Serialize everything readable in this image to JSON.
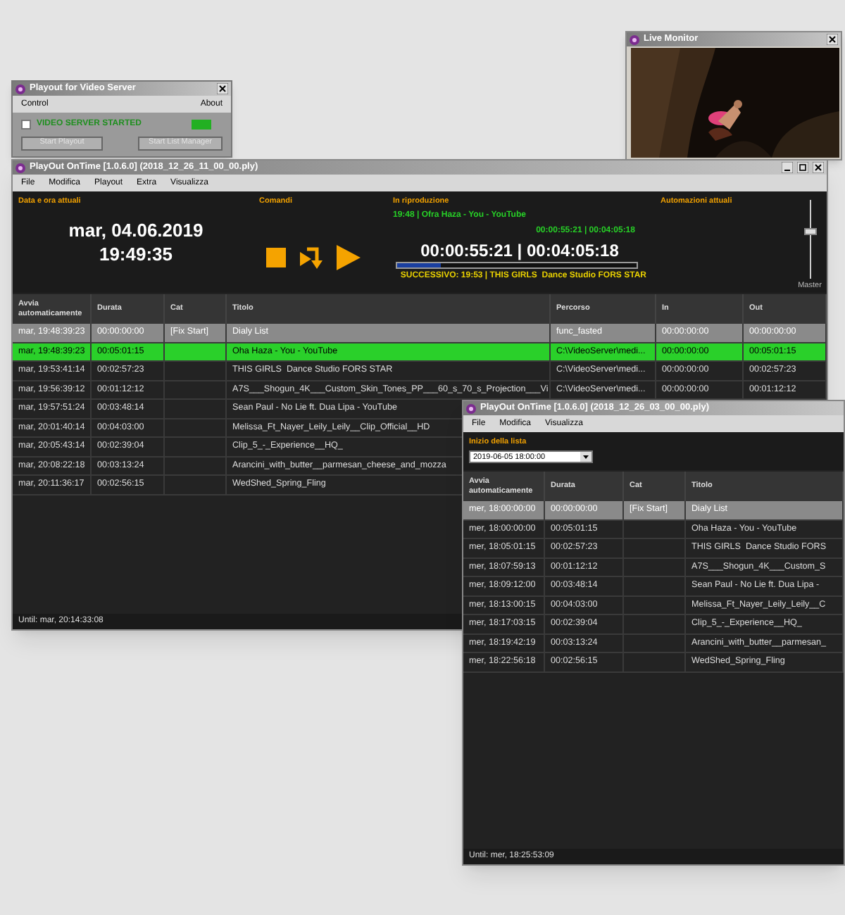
{
  "server_window": {
    "title": "Playout for Video Server",
    "menu": [
      "Control",
      "About"
    ],
    "checkbox": {
      "label": "VIDEO SERVER STARTED",
      "checked": false
    },
    "indicator": {
      "on": true
    },
    "buttons": [
      {
        "label": "Start Playout",
        "disabled": true
      },
      {
        "label": "Start List Manager",
        "disabled": true
      }
    ]
  },
  "monitor_window": {
    "title": "Live Monitor"
  },
  "main_window": {
    "title": "PlayOut OnTime [1.0.6.0] (2018_12_26_11_00_00.ply)",
    "menu": [
      "File",
      "Modifica",
      "Playout",
      "Extra",
      "Visualizza"
    ],
    "panel": {
      "date_label": "Data e ora attuali",
      "date": "mar, 04.06.2019",
      "time": "19:49:35",
      "commands_label": "Comandi",
      "now_playing_label": "In riproduzione",
      "now_playing": "19:48 | Ofra Haza - You - YouTube",
      "elapsed_small": "00:00:55:21 | 00:04:05:18",
      "elapsed": "00:00:55:21 | 00:04:05:18",
      "progress": {
        "level": 0.18
      },
      "next": "SUCCESSIVO: 19:53 | THIS GIRLS  Dance Studio FORS STAR",
      "automations_label": "Automazioni attuali",
      "master": {
        "label": "Master",
        "level": 0.6
      }
    },
    "columns": [
      "Avvia automaticamente",
      "Durata",
      "Cat",
      "Titolo",
      "Percorso",
      "In",
      "Out"
    ],
    "rows": [
      {
        "cells": [
          "mar, 19:48:39:23",
          "00:00:00:00",
          "[Fix Start]",
          "Dialy List",
          "func_fasted",
          "00:00:00:00",
          "00:00:00:00"
        ],
        "selected": true,
        "playing": false
      },
      {
        "cells": [
          "mar, 19:48:39:23",
          "00:05:01:15",
          "",
          "Oha Haza - You - YouTube",
          "C:\\VideoServer\\medi...",
          "00:00:00:00",
          "00:05:01:15"
        ],
        "selected": false,
        "playing": true
      },
      {
        "cells": [
          "mar, 19:53:41:14",
          "00:02:57:23",
          "",
          "THIS GIRLS  Dance Studio FORS STAR",
          "C:\\VideoServer\\medi...",
          "00:00:00:00",
          "00:02:57:23"
        ],
        "selected": false,
        "playing": false
      },
      {
        "cells": [
          "mar, 19:56:39:12",
          "00:01:12:12",
          "",
          "A7S___Shogun_4K___Custom_Skin_Tones_PP___60_s_70_s_Projection___Vi",
          "C:\\VideoServer\\medi...",
          "00:00:00:00",
          "00:01:12:12"
        ],
        "selected": false,
        "playing": false
      },
      {
        "cells": [
          "mar, 19:57:51:24",
          "00:03:48:14",
          "",
          "Sean Paul - No Lie ft. Dua Lipa - YouTube"
        ],
        "selected": false,
        "playing": false
      },
      {
        "cells": [
          "mar, 20:01:40:14",
          "00:04:03:00",
          "",
          "Melissa_Ft_Nayer_Leily_Leily__Clip_Official__HD"
        ],
        "selected": false,
        "playing": false
      },
      {
        "cells": [
          "mar, 20:05:43:14",
          "00:02:39:04",
          "",
          "Clip_5_-_Experience__HQ_"
        ],
        "selected": false,
        "playing": false
      },
      {
        "cells": [
          "mar, 20:08:22:18",
          "00:03:13:24",
          "",
          "Arancini_with_butter__parmesan_cheese_and_mozza"
        ],
        "selected": false,
        "playing": false
      },
      {
        "cells": [
          "mar, 20:11:36:17",
          "00:02:56:15",
          "",
          "WedShed_Spring_Fling"
        ],
        "selected": false,
        "playing": false
      }
    ],
    "status": "Until: mar, 20:14:33:08"
  },
  "list_window": {
    "title": "PlayOut OnTime [1.0.6.0] (2018_12_26_03_00_00.ply)",
    "menu": [
      "File",
      "Modifica",
      "Visualizza"
    ],
    "start_label": "Inizio della lista",
    "start_value": "2019-06-05 18:00:00",
    "columns": [
      "Avvia automaticamente",
      "Durata",
      "Cat",
      "Titolo"
    ],
    "rows": [
      {
        "cells": [
          "mer, 18:00:00:00",
          "00:00:00:00",
          "[Fix Start]",
          "Dialy List"
        ],
        "selected": true
      },
      {
        "cells": [
          "mer, 18:00:00:00",
          "00:05:01:15",
          "",
          "Oha Haza - You - YouTube"
        ],
        "selected": false
      },
      {
        "cells": [
          "mer, 18:05:01:15",
          "00:02:57:23",
          "",
          "THIS GIRLS  Dance Studio FORS"
        ],
        "selected": false
      },
      {
        "cells": [
          "mer, 18:07:59:13",
          "00:01:12:12",
          "",
          "A7S___Shogun_4K___Custom_S"
        ],
        "selected": false
      },
      {
        "cells": [
          "mer, 18:09:12:00",
          "00:03:48:14",
          "",
          "Sean Paul - No Lie ft. Dua Lipa -"
        ],
        "selected": false
      },
      {
        "cells": [
          "mer, 18:13:00:15",
          "00:04:03:00",
          "",
          "Melissa_Ft_Nayer_Leily_Leily__C"
        ],
        "selected": false
      },
      {
        "cells": [
          "mer, 18:17:03:15",
          "00:02:39:04",
          "",
          "Clip_5_-_Experience__HQ_"
        ],
        "selected": false
      },
      {
        "cells": [
          "mer, 18:19:42:19",
          "00:03:13:24",
          "",
          "Arancini_with_butter__parmesan_"
        ],
        "selected": false
      },
      {
        "cells": [
          "mer, 18:22:56:18",
          "00:02:56:15",
          "",
          "WedShed_Spring_Fling"
        ],
        "selected": false
      }
    ],
    "status": "Until: mer, 18:25:53:09"
  }
}
